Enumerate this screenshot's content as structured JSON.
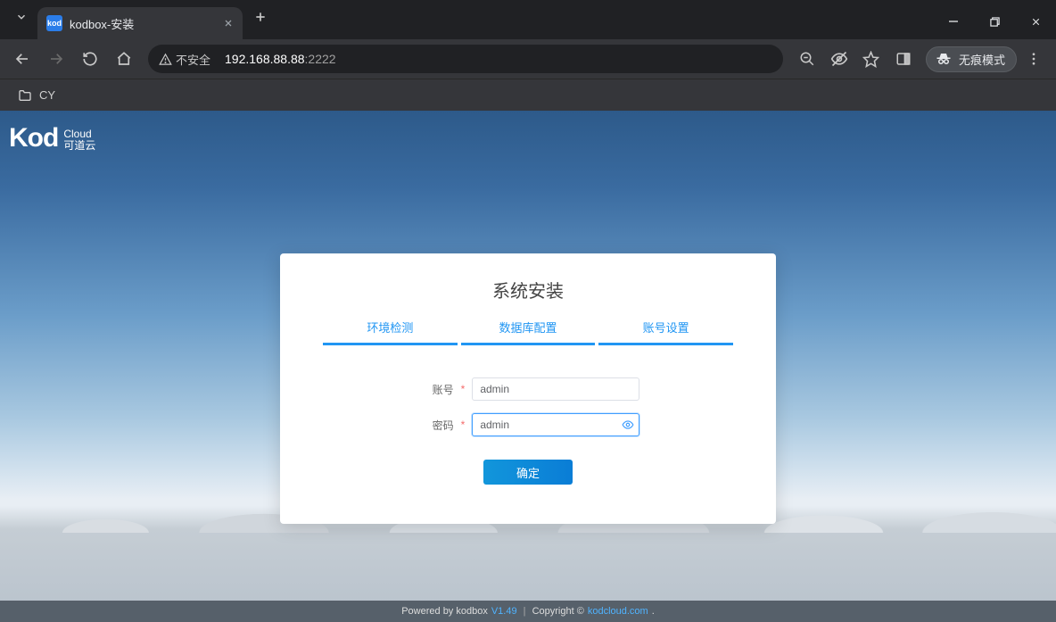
{
  "browser": {
    "tab_title": "kodbox-安装",
    "favicon_text": "kod",
    "security_label": "不安全",
    "url_host": "192.168.88.88",
    "url_port": ":2222",
    "incognito_label": "无痕模式",
    "bookmark_cy": "CY"
  },
  "logo": {
    "main": "Kod",
    "line1": "Cloud",
    "line2": "可道云"
  },
  "card": {
    "title": "系统安装",
    "steps": [
      "环境检测",
      "数据库配置",
      "账号设置"
    ],
    "account_label": "账号",
    "password_label": "密码",
    "account_value": "admin",
    "password_value": "admin",
    "submit": "确定"
  },
  "footer": {
    "prefix": "Powered by kodbox ",
    "version": "V1.49",
    "mid": "Copyright © ",
    "link": "kodcloud.com ",
    "suffix": "."
  }
}
